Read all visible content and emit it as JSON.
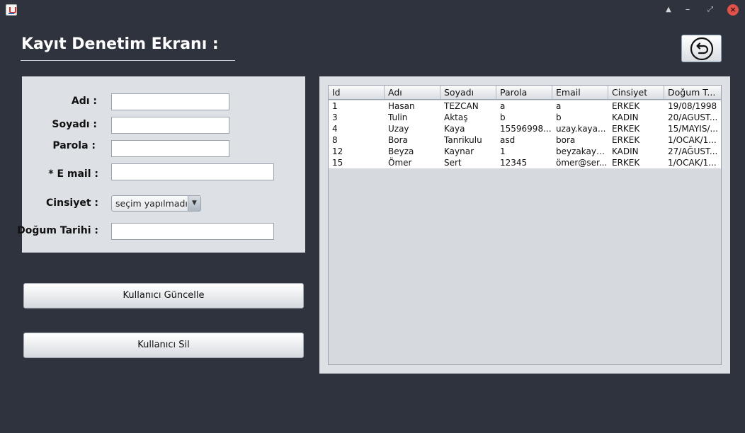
{
  "window": {
    "eject_icon": "▲",
    "minimize_icon": "–",
    "maximize_icon": "⤢",
    "close_icon": "×"
  },
  "header": {
    "title": "Kayıt Denetim Ekranı :"
  },
  "back_button": {
    "icon": "undo-arrow-icon"
  },
  "form": {
    "name_label": "Adı :",
    "name_value": "",
    "surname_label": "Soyadı :",
    "surname_value": "",
    "password_label": "Parola :",
    "password_value": "",
    "email_label": "* E mail :",
    "email_value": "",
    "gender_label": "Cinsiyet :",
    "gender_selected": "seçim yapılmadı",
    "gender_arrow": "▼",
    "birthdate_label": "Doğum Tarihi :",
    "birthdate_value": ""
  },
  "buttons": {
    "update_label": "Kullanıcı Güncelle",
    "delete_label": "Kullanıcı Sil"
  },
  "table": {
    "columns": [
      "Id",
      "Adı",
      "Soyadı",
      "Parola",
      "Email",
      "Cinsiyet",
      "Doğum T..."
    ],
    "rows": [
      [
        "1",
        "Hasan",
        "TEZCAN",
        "a",
        "a",
        "ERKEK",
        "19/08/1998"
      ],
      [
        "3",
        "Tulin",
        "Aktaş",
        "b",
        "b",
        "KADIN",
        "20/AGUST..."
      ],
      [
        "4",
        "Uzay",
        "Kaya",
        "15596998...",
        "uzay.kaya...",
        "ERKEK",
        "15/MAYIS/..."
      ],
      [
        "8",
        "Bora",
        "Tanrikulu",
        "asd",
        "bora",
        "ERKEK",
        "1/OCAK/1..."
      ],
      [
        "12",
        "Beyza",
        "Kaynar",
        "1",
        "beyzakayn...",
        "KADIN",
        "27/AĞUST..."
      ],
      [
        "15",
        "Ömer",
        "Sert",
        "12345",
        "ömer@ser...",
        "ERKEK",
        "1/OCAK/1..."
      ]
    ]
  }
}
